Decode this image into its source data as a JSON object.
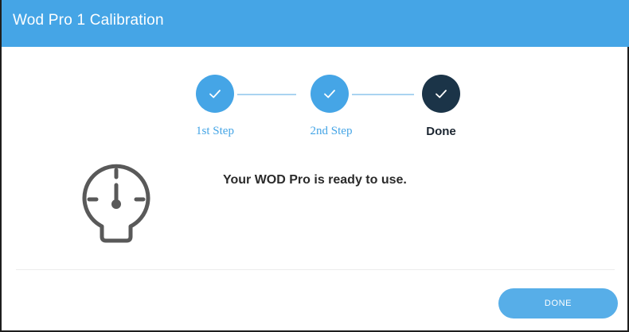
{
  "dialog": {
    "title": "Wod Pro 1 Calibration"
  },
  "stepper": {
    "steps": [
      {
        "label": "1st Step",
        "state": "completed"
      },
      {
        "label": "2nd Step",
        "state": "completed"
      },
      {
        "label": "Done",
        "state": "current"
      }
    ]
  },
  "content": {
    "message": "Your WOD Pro is ready to use.",
    "icon": "gauge-icon"
  },
  "footer": {
    "done_label": "DONE"
  },
  "colors": {
    "accent": "#45a5e6",
    "active_step": "#1b3448",
    "connector": "#a9d3f0",
    "button": "#57aee8"
  }
}
